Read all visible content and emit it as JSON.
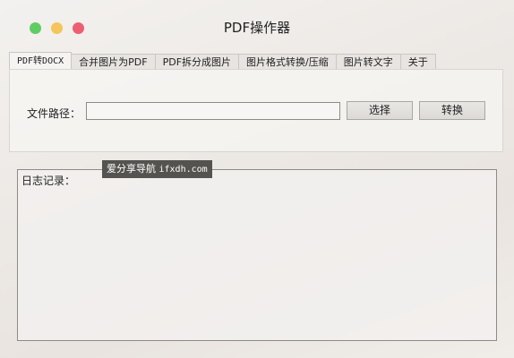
{
  "window": {
    "title": "PDF操作器",
    "controls": [
      "close",
      "minimize",
      "maximize"
    ]
  },
  "tabs": [
    {
      "label": "PDF转DOCX",
      "active": true
    },
    {
      "label": "合并图片为PDF",
      "active": false
    },
    {
      "label": "PDF拆分成图片",
      "active": false
    },
    {
      "label": "图片格式转换/压缩",
      "active": false
    },
    {
      "label": "图片转文字",
      "active": false
    },
    {
      "label": "关于",
      "active": false
    }
  ],
  "form": {
    "path_label": "文件路径：",
    "path_value": "",
    "select_button": "选择",
    "convert_button": "转换"
  },
  "log": {
    "label": "日志记录："
  },
  "watermark": {
    "text_cn": "爱分享导航",
    "text_url": "ifxdh.com"
  },
  "colors": {
    "close": "#5fcd64",
    "minimize": "#f3c55b",
    "maximize": "#ec5f72"
  }
}
